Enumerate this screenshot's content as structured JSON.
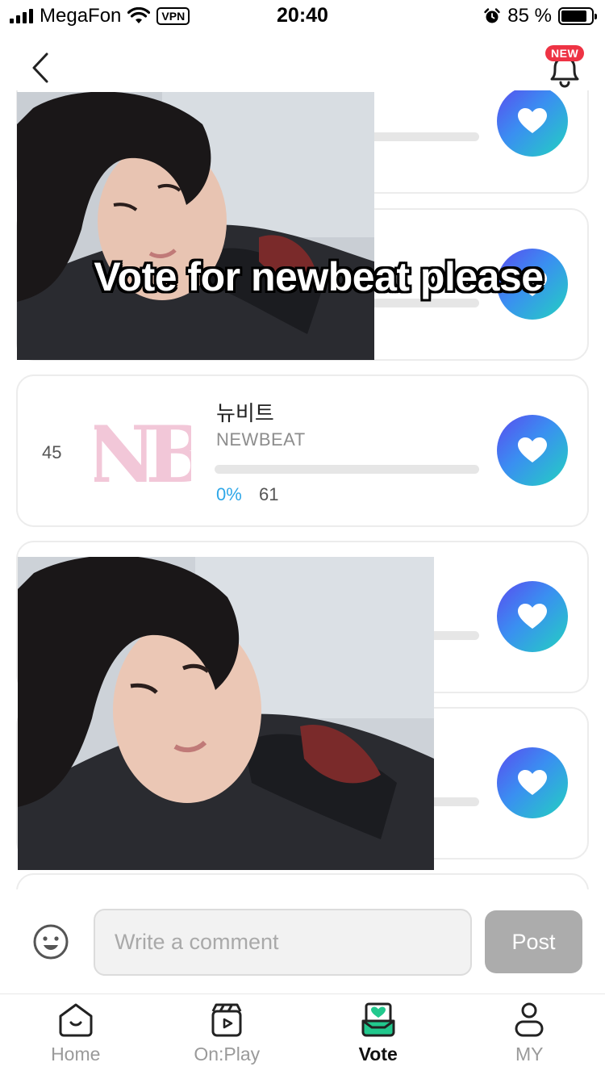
{
  "status_bar": {
    "carrier": "MegaFon",
    "vpn": "VPN",
    "time": "20:40",
    "battery": "85 %",
    "battery_level": 0.85
  },
  "header": {
    "back_icon": "chevron-left-icon",
    "notification_icon": "bell-icon",
    "new_badge": "NEW"
  },
  "overlay_caption": "Vote for newbeat please",
  "entries": [
    {
      "rank": "",
      "name_ko": "",
      "name_en": "",
      "percent": "",
      "votes": "",
      "bar_fill": 0
    },
    {
      "rank": "",
      "name_ko": "",
      "name_en": "",
      "percent": "",
      "votes": "",
      "bar_fill": 0
    },
    {
      "rank": "45",
      "name_ko": "뉴비트",
      "name_en": "NEWBEAT",
      "percent": "0%",
      "votes": "61",
      "bar_fill": 0,
      "logo": "NB"
    },
    {
      "rank": "",
      "name_ko": "",
      "name_en": "",
      "percent": "",
      "votes": "",
      "bar_fill": 0
    },
    {
      "rank": "",
      "name_ko": "",
      "name_en": "",
      "percent": "",
      "votes": "",
      "bar_fill": 0
    }
  ],
  "comment": {
    "placeholder": "Write a comment",
    "value": "",
    "post_label": "Post",
    "emoji_icon": "smiley-icon"
  },
  "nav": {
    "items": [
      {
        "label": "Home",
        "icon": "home-icon",
        "active": false
      },
      {
        "label": "On:Play",
        "icon": "clapperboard-play-icon",
        "active": false
      },
      {
        "label": "Vote",
        "icon": "vote-box-heart-icon",
        "active": true
      },
      {
        "label": "MY",
        "icon": "person-icon",
        "active": false
      }
    ]
  },
  "colors": {
    "vote_gradient_start": "#5a4bf0",
    "vote_gradient_end": "#23d1c0",
    "percent_blue": "#2ea7e8",
    "vote_icon_green": "#22c88d",
    "new_badge_red": "#ee3344",
    "logo_pink": "#f2c7d8"
  }
}
